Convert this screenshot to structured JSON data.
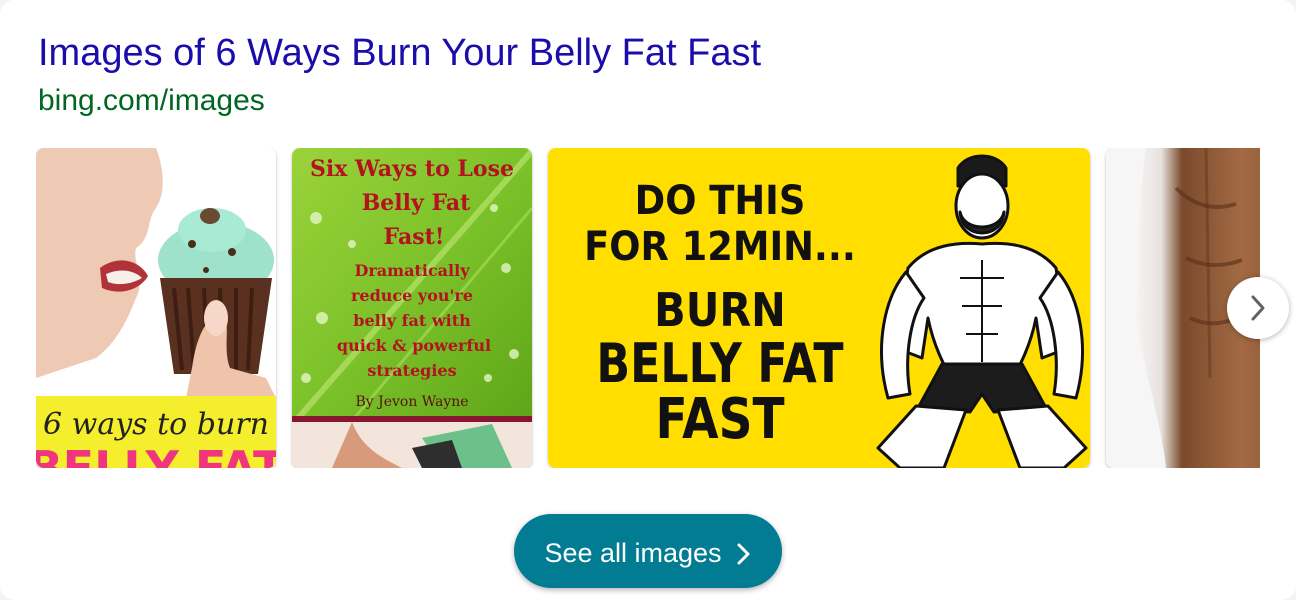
{
  "result": {
    "title": "Images of 6 Ways Burn Your Belly Fat Fast",
    "source": "bing.com/images"
  },
  "images": [
    {
      "name": "Cupcake woman",
      "lines": [
        "6 ways to burn",
        "BELLY FAT"
      ]
    },
    {
      "name": "Book cover",
      "lines": [
        "Six Ways to Lose",
        "Belly Fat",
        "Fast!",
        "Dramatically",
        "reduce you're",
        "belly fat with",
        "quick & powerful",
        "strategies",
        "By Jevon Wayne"
      ]
    },
    {
      "name": "Workout graphic",
      "lines": [
        "DO THIS",
        "FOR 12MIN...",
        "BURN",
        "BELLY FAT",
        "FAST"
      ]
    },
    {
      "name": "Torso photo",
      "lines": []
    }
  ],
  "carousel": {
    "next_icon": "chevron-right-icon"
  },
  "see_all": {
    "label": "See all images",
    "icon": "chevron-right-icon"
  },
  "colors": {
    "title": "#1a0dab",
    "source": "#006621",
    "button": "#017c92",
    "yellow": "#ffde00"
  }
}
